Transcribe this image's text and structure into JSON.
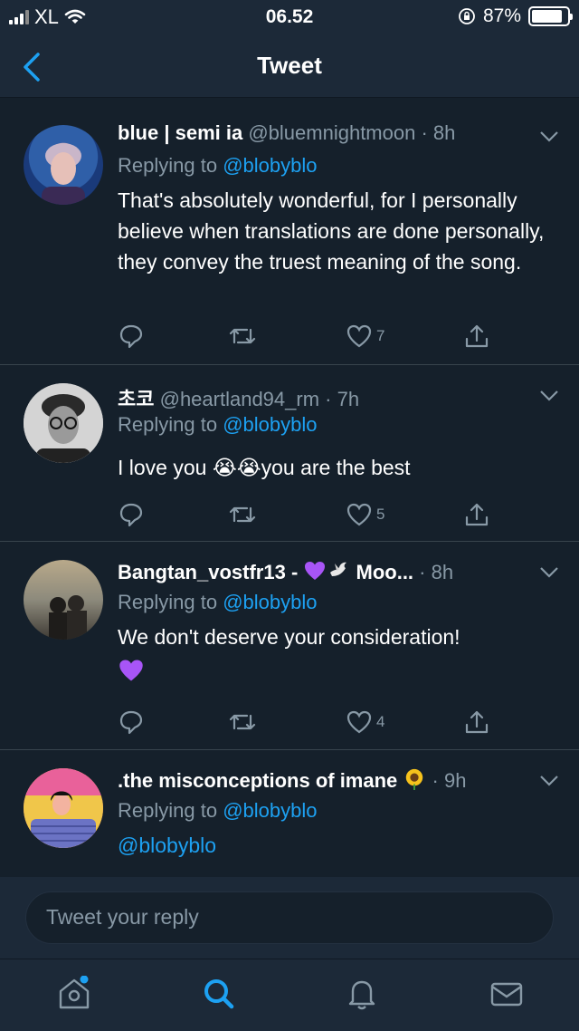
{
  "status_bar": {
    "carrier": "XL",
    "time": "06.52",
    "battery": "87%",
    "battery_fraction": 0.87
  },
  "header": {
    "title": "Tweet"
  },
  "tweets": [
    {
      "name": "blue | semi ia",
      "handle": "@bluemnightmoon",
      "time": "8h",
      "replying_label": "Replying to ",
      "replying_to": "@blobyblo",
      "text": "That's absolutely wonderful, for I personally believe when translations are done personally, they convey the truest meaning of the song.",
      "likes": "7"
    },
    {
      "name": "초코",
      "handle": "@heartland94_rm",
      "time": "7h",
      "replying_label": "Replying to ",
      "replying_to": "@blobyblo",
      "text_before": "I love you ",
      "emojis": "😭😭",
      "text_after": "you are the best",
      "likes": "5"
    },
    {
      "name": "Bangtan_vostfr13 - ",
      "name_suffix": " Moo...",
      "time": "8h",
      "replying_label": "Replying to ",
      "replying_to": "@blobyblo",
      "text": "We don't deserve your consideration!",
      "likes": "4"
    },
    {
      "name": ".the misconceptions of imane ",
      "time": "9h",
      "replying_label": "Replying to ",
      "replying_to": "@blobyblo",
      "text": "@blobyblo"
    }
  ],
  "compose": {
    "placeholder": "Tweet your reply"
  },
  "colors": {
    "background": "#15202b",
    "bar": "#1c2938",
    "accent": "#1da1f2",
    "muted": "#8899a6",
    "divider": "#38444d"
  },
  "icons": [
    "back-chevron-icon",
    "chevron-down-icon",
    "reply-icon",
    "retweet-icon",
    "like-icon",
    "share-icon",
    "home-icon",
    "search-icon",
    "notifications-icon",
    "messages-icon"
  ]
}
